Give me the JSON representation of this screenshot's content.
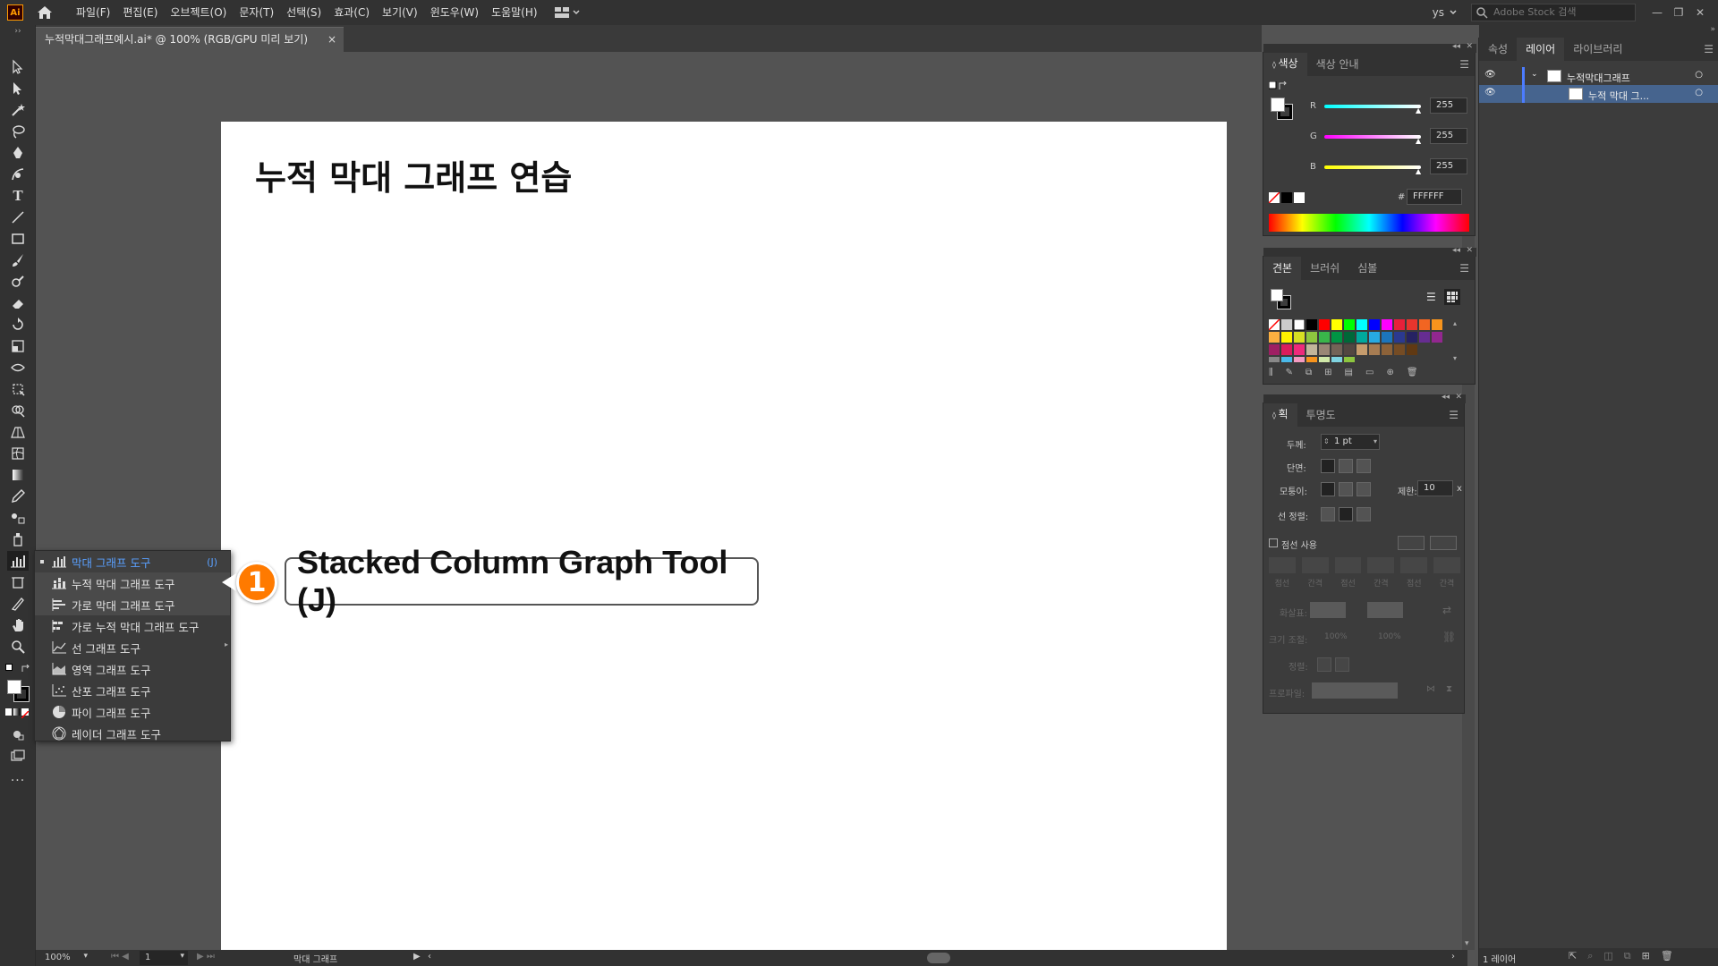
{
  "app": {
    "logo": "Ai"
  },
  "menu": [
    "파일(F)",
    "편집(E)",
    "오브젝트(O)",
    "문자(T)",
    "선택(S)",
    "효과(C)",
    "보기(V)",
    "윈도우(W)",
    "도움말(H)"
  ],
  "user": "ys",
  "search_placeholder": "Adobe Stock 검색",
  "document_tab": {
    "title": "누적막대그래프예시.ai* @ 100% (RGB/GPU 미리 보기)",
    "close": "×"
  },
  "artboard": {
    "heading": "누적 막대 그래프 연습"
  },
  "flyout": {
    "items": [
      {
        "label": "막대 그래프 도구",
        "shortcut": "(J)",
        "icon": "column-graph-icon"
      },
      {
        "label": "누적 막대 그래프 도구",
        "icon": "stacked-column-graph-icon"
      },
      {
        "label": "가로 막대 그래프 도구",
        "icon": "bar-graph-icon"
      },
      {
        "label": "가로 누적 막대 그래프 도구",
        "icon": "stacked-bar-graph-icon"
      },
      {
        "label": "선 그래프 도구",
        "icon": "line-graph-icon"
      },
      {
        "label": "영역 그래프 도구",
        "icon": "area-graph-icon"
      },
      {
        "label": "산포 그래프 도구",
        "icon": "scatter-graph-icon"
      },
      {
        "label": "파이 그래프 도구",
        "icon": "pie-graph-icon"
      },
      {
        "label": "레이더 그래프 도구",
        "icon": "radar-graph-icon"
      }
    ]
  },
  "callout": {
    "number": "1",
    "text": "Stacked Column Graph Tool (J)",
    "color": "#ff7a00"
  },
  "color_panel": {
    "tabs": [
      "색상",
      "색상 안내"
    ],
    "r_label": "R",
    "g_label": "G",
    "b_label": "B",
    "r": "255",
    "g": "255",
    "b": "255",
    "hex_prefix": "#",
    "hex": "FFFFFF"
  },
  "swatches_panel": {
    "tabs": [
      "견본",
      "브러쉬",
      "심볼"
    ]
  },
  "stroke_panel": {
    "tabs": [
      "획",
      "투명도"
    ],
    "weight_label": "두께:",
    "weight_value": "1 pt",
    "cap_label": "단면:",
    "corner_label": "모퉁이:",
    "limit_label": "제한:",
    "limit_value": "10",
    "limit_x": "x",
    "align_label": "선 정렬:",
    "dashed_label": "점선 사용",
    "dash_labels": [
      "점선",
      "간격",
      "점선",
      "간격",
      "점선",
      "간격"
    ],
    "arrow_label": "화살표:",
    "scale_label": "크기 조절:",
    "scale_1": "100%",
    "scale_2": "100%",
    "align2_label": "정렬:",
    "profile_label": "프로파일:"
  },
  "layers_panel": {
    "tabs": [
      "속성",
      "레이어",
      "라이브러리"
    ],
    "layer_name": "누적막대그래프",
    "sublayer_name": "누적 막대 그...",
    "footer": "1 레이어"
  },
  "status": {
    "zoom": "100%",
    "artboard_num": "1",
    "tool_name": "막대 그래프"
  }
}
